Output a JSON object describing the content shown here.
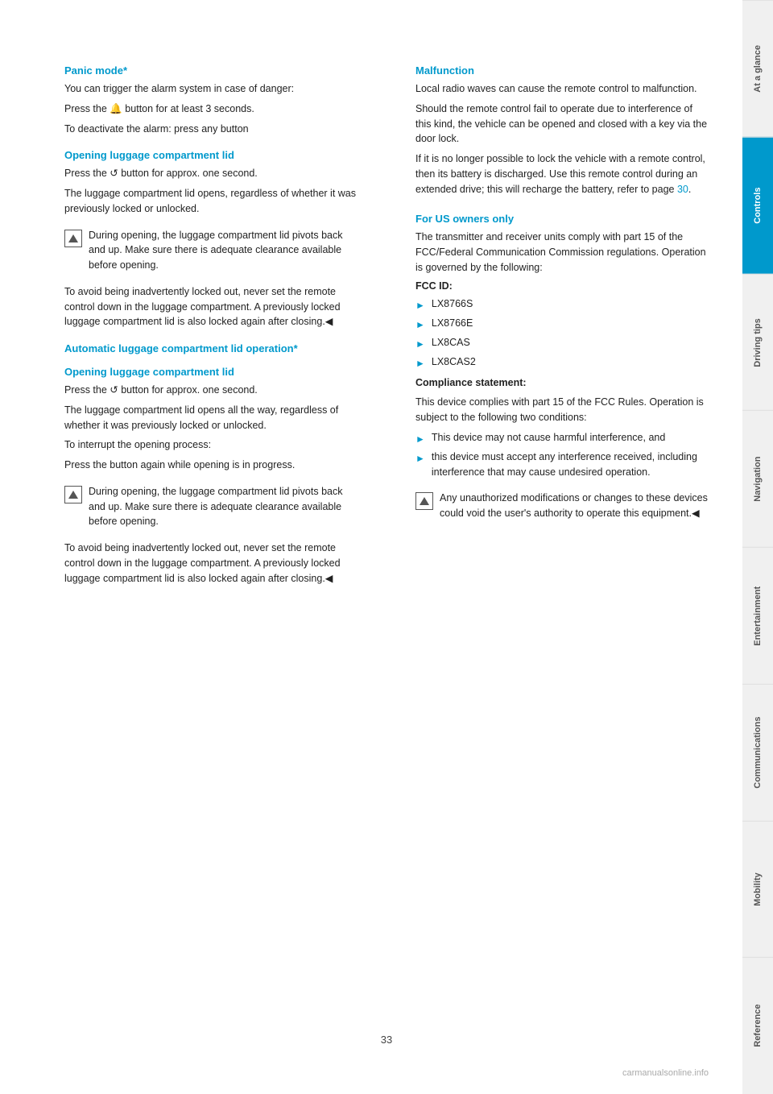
{
  "page": {
    "number": "33",
    "watermark": "carmanualsonline.info"
  },
  "sidebar": {
    "tabs": [
      {
        "label": "At a glance",
        "active": false
      },
      {
        "label": "Controls",
        "active": true
      },
      {
        "label": "Driving tips",
        "active": false
      },
      {
        "label": "Navigation",
        "active": false
      },
      {
        "label": "Entertainment",
        "active": false
      },
      {
        "label": "Communications",
        "active": false
      },
      {
        "label": "Mobility",
        "active": false
      },
      {
        "label": "Reference",
        "active": false
      }
    ]
  },
  "left": {
    "panic_mode_title": "Panic mode*",
    "panic_mode_text1": "You can trigger the alarm system in case of danger:",
    "panic_mode_text2": "Press the 🔔 button for at least 3 seconds.",
    "panic_mode_text3": "To deactivate the alarm: press any button",
    "opening_lid_title": "Opening luggage compartment lid",
    "opening_lid_text1": "Press the ↺ button for approx. one second.",
    "opening_lid_text2": "The luggage compartment lid opens, regardless of whether it was previously locked or unlocked.",
    "opening_lid_note1": "During opening, the luggage compartment lid pivots back and up. Make sure there is adequate clearance available before opening.",
    "opening_lid_text3": "To avoid being inadvertently locked out, never set the remote control down in the luggage compartment. A previously locked luggage compartment lid is also locked again after closing.",
    "auto_title": "Automatic luggage compartment lid operation*",
    "auto_sub_title": "Opening luggage compartment lid",
    "auto_text1": "Press the ↺ button for approx. one second.",
    "auto_text2": "The luggage compartment lid opens all the way, regardless of whether it was previously locked or unlocked.",
    "auto_text3": "To interrupt the opening process:",
    "auto_text4": "Press the button again while opening is in progress.",
    "auto_note1": "During opening, the luggage compartment lid pivots back and up. Make sure there is adequate clearance available before opening.",
    "auto_text5": "To avoid being inadvertently locked out, never set the remote control down in the luggage compartment. A previously locked luggage compartment lid is also locked again after closing."
  },
  "right": {
    "malfunction_title": "Malfunction",
    "malfunction_text1": "Local radio waves can cause the remote control to malfunction.",
    "malfunction_text2": "Should the remote control fail to operate due to interference of this kind, the vehicle can be opened and closed with a key via the door lock.",
    "malfunction_text3": "If it is no longer possible to lock the vehicle with a remote control, then its battery is discharged. Use this remote control during an extended drive; this will recharge the battery, refer to page 30.",
    "page_link": "30",
    "fcc_title": "For US owners only",
    "fcc_text1": "The transmitter and receiver units comply with part 15 of the FCC/Federal Communication Commission regulations. Operation is governed by the following:",
    "fcc_id_label": "FCC ID:",
    "fcc_ids": [
      "LX8766S",
      "LX8766E",
      "LX8CAS",
      "LX8CAS2"
    ],
    "compliance_label": "Compliance statement:",
    "compliance_text1": "This device complies with part 15 of the FCC Rules. Operation is subject to the following two conditions:",
    "compliance_bullets": [
      "This device may not cause harmful interference, and",
      "this device must accept any interference received, including interference that may cause undesired operation."
    ],
    "compliance_note": "Any unauthorized modifications or changes to these devices could void the user's authority to operate this equipment."
  }
}
